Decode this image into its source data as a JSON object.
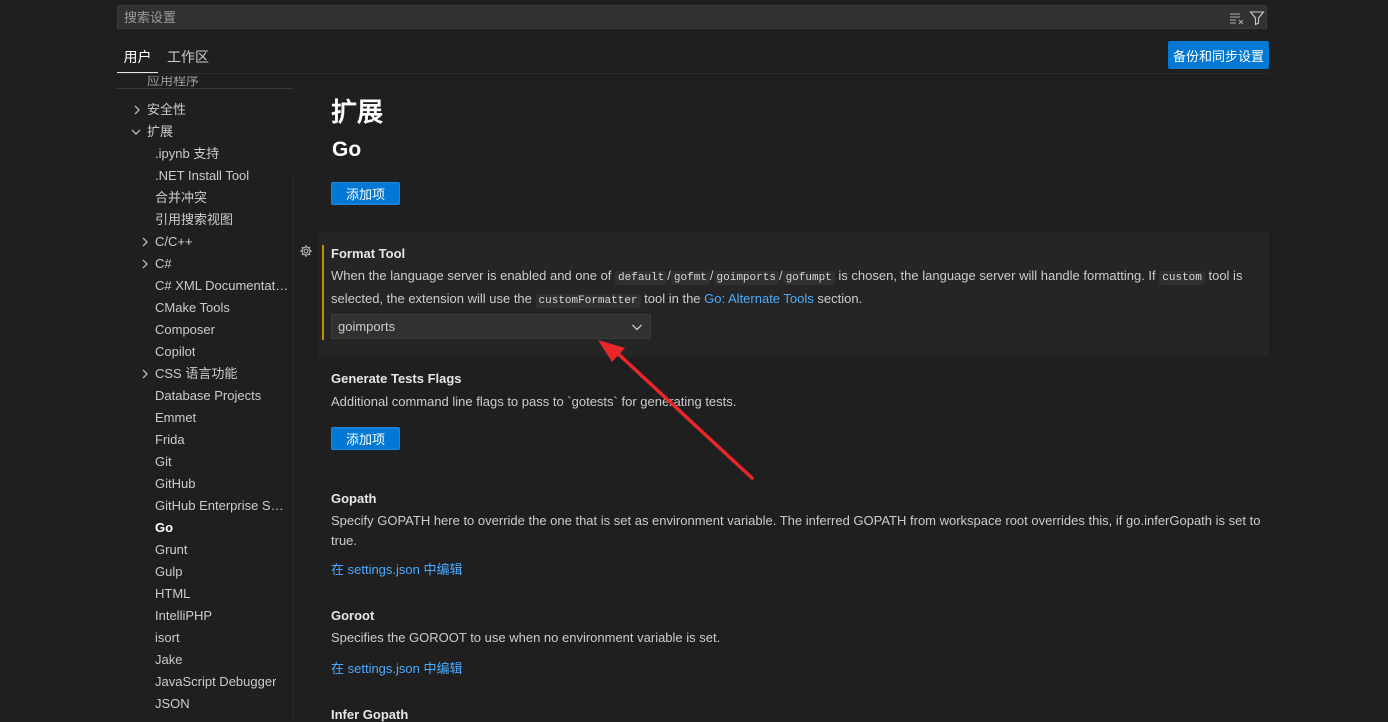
{
  "search": {
    "placeholder": "搜索设置"
  },
  "tabs": [
    {
      "label": "用户"
    },
    {
      "label": "工作区"
    }
  ],
  "sync_button": "备份和同步设置",
  "tree": {
    "top_partial": "应用程序",
    "items": [
      {
        "label": "安全性"
      },
      {
        "label": "扩展"
      },
      {
        "label": ".ipynb 支持"
      },
      {
        "label": ".NET Install Tool"
      },
      {
        "label": "合并冲突"
      },
      {
        "label": "引用搜索视图"
      },
      {
        "label": "C/C++"
      },
      {
        "label": "C#"
      },
      {
        "label": "C# XML Documentation Comments"
      },
      {
        "label": "CMake Tools"
      },
      {
        "label": "Composer"
      },
      {
        "label": "Copilot"
      },
      {
        "label": "CSS 语言功能"
      },
      {
        "label": "Database Projects"
      },
      {
        "label": "Emmet"
      },
      {
        "label": "Frida"
      },
      {
        "label": "Git"
      },
      {
        "label": "GitHub"
      },
      {
        "label": "GitHub Enterprise Server Authentication"
      },
      {
        "label": "Go"
      },
      {
        "label": "Grunt"
      },
      {
        "label": "Gulp"
      },
      {
        "label": "HTML"
      },
      {
        "label": "IntelliPHP"
      },
      {
        "label": "isort"
      },
      {
        "label": "Jake"
      },
      {
        "label": "JavaScript Debugger"
      },
      {
        "label": "JSON"
      }
    ]
  },
  "main": {
    "title": "扩展",
    "subtitle": "Go",
    "add_item": "添加项",
    "format_tool": {
      "title": "Format Tool",
      "desc_1": "When the language server is enabled and one of ",
      "code_default": "default",
      "slash": "/",
      "code_gofmt": "gofmt",
      "code_goimports": "goimports",
      "code_gofumpt": "gofumpt",
      "desc_2": " is chosen, the language server will handle formatting. If ",
      "code_custom": "custom",
      "desc_3": " tool is selected, the extension will use the ",
      "code_customFormatter": "customFormatter",
      "desc_4": " tool in the ",
      "link": "Go: Alternate Tools",
      "desc_5": " section.",
      "value": "goimports"
    },
    "gen_tests": {
      "title": "Generate Tests Flags",
      "desc": "Additional command line flags to pass to `gotests` for generating tests."
    },
    "gopath": {
      "title": "Gopath",
      "desc": "Specify GOPATH here to override the one that is set as environment variable. The inferred GOPATH from workspace root overrides this, if go.inferGopath is set to true."
    },
    "goroot": {
      "title": "Goroot",
      "desc": "Specifies the GOROOT to use when no environment variable is set."
    },
    "edit_json": "在 settings.json 中编辑",
    "infer_gopath": {
      "title": "Infer Gopath"
    }
  },
  "colors": {
    "accent": "#0078d4",
    "link": "#4daafc",
    "annotation": "#e8272a",
    "modified": "#b89500"
  }
}
